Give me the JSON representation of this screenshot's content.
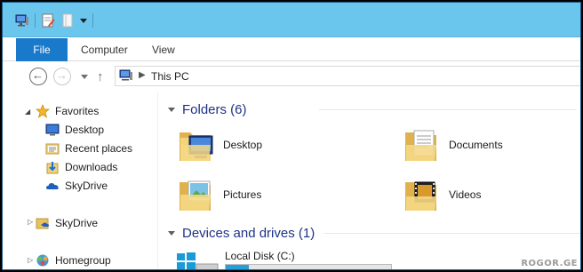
{
  "titlebar": {
    "color": "#6bc6ee",
    "quick_access": [
      "computer-icon",
      "properties-icon",
      "new-folder-icon",
      "customize-dropdown"
    ]
  },
  "ribbon": {
    "tabs": [
      {
        "label": "File",
        "active": true
      },
      {
        "label": "Computer"
      },
      {
        "label": "View"
      }
    ],
    "file_color": "#1979ca"
  },
  "address": {
    "location_icon": "this-pc-icon",
    "path": "This PC"
  },
  "nav": {
    "favorites": {
      "label": "Favorites",
      "items": [
        {
          "label": "Desktop",
          "icon": "desktop-icon"
        },
        {
          "label": "Recent places",
          "icon": "recent-places-icon"
        },
        {
          "label": "Downloads",
          "icon": "downloads-icon"
        },
        {
          "label": "SkyDrive",
          "icon": "skydrive-icon"
        }
      ]
    },
    "skydrive": {
      "label": "SkyDrive"
    },
    "homegroup": {
      "label": "Homegroup"
    }
  },
  "folders": {
    "title": "Folders (6)",
    "items": [
      {
        "label": "Desktop",
        "icon": "desktop-folder-icon"
      },
      {
        "label": "Documents",
        "icon": "documents-folder-icon"
      },
      {
        "label": "Pictures",
        "icon": "pictures-folder-icon"
      },
      {
        "label": "Videos",
        "icon": "videos-folder-icon"
      }
    ]
  },
  "devices": {
    "title": "Devices and drives (1)",
    "drives": [
      {
        "label": "Local Disk (C:)",
        "icon": "windows-drive-icon",
        "used_fraction": 0.14
      }
    ]
  },
  "watermark": "ROGOR.GE"
}
